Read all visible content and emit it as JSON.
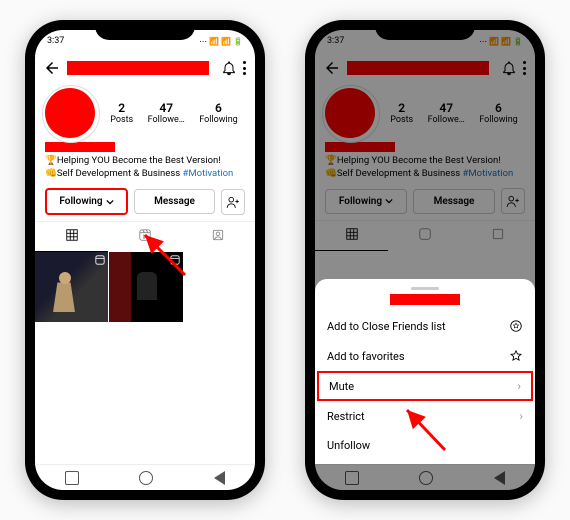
{
  "status": {
    "time": "3:37",
    "right": "⋯ 📶 📶 🔋"
  },
  "topbar": {
    "username_redacted": true
  },
  "stats": {
    "posts": {
      "count": "2",
      "label": "Posts"
    },
    "followers": {
      "count": "47",
      "label": "Followe…"
    },
    "following": {
      "count": "6",
      "label": "Following"
    }
  },
  "bio": {
    "name_redacted": true,
    "line1_emoji": "🏆",
    "line1_text": "Helping YOU Become the Best Version!",
    "line2_emoji": "👊",
    "line2_text": "Self Development & Business ",
    "hashtag": "#Motivation"
  },
  "buttons": {
    "following": "Following",
    "message": "Message"
  },
  "sheet": {
    "items": [
      {
        "label": "Add to Close Friends list",
        "icon": "close-friends-icon"
      },
      {
        "label": "Add to favorites",
        "icon": "star-icon"
      },
      {
        "label": "Mute",
        "icon": "chevron-right-icon",
        "highlight": true
      },
      {
        "label": "Restrict",
        "icon": "chevron-right-icon"
      },
      {
        "label": "Unfollow",
        "icon": null
      }
    ]
  }
}
